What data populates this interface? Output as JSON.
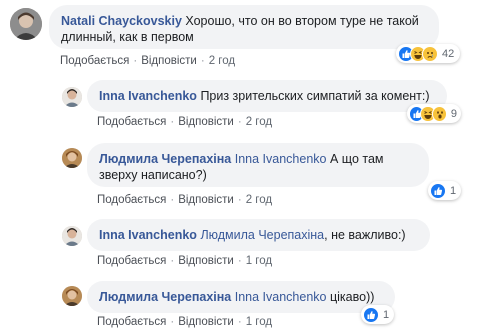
{
  "comments": [
    {
      "author": "Natali Chayckovskiy",
      "mention": "",
      "text": "Хорошо, что он во втором туре не такой длинный, как в первом",
      "actions": {
        "like": "Подобається",
        "reply": "Відповісти",
        "time": "2 год"
      },
      "reactions": {
        "icons": [
          "like-icon",
          "haha-icon",
          "sad-icon"
        ],
        "count": "42"
      }
    },
    {
      "author": "Inna Ivanchenko",
      "mention": "",
      "text": "Приз зрительских симпатий за комент:)",
      "actions": {
        "like": "Подобається",
        "reply": "Відповісти",
        "time": "2 год"
      },
      "reactions": {
        "icons": [
          "like-icon",
          "haha-icon",
          "wow-icon"
        ],
        "count": "9"
      }
    },
    {
      "author": "Людмила Черепахіна",
      "mention": "Inna Ivanchenko",
      "text": "А що там зверху написано?)",
      "actions": {
        "like": "Подобається",
        "reply": "Відповісти",
        "time": "2 год"
      },
      "reactions": {
        "icons": [
          "like-icon"
        ],
        "count": "1"
      }
    },
    {
      "author": "Inna Ivanchenko",
      "mention": "Людмила Черепахіна",
      "text": ", не важливо:)",
      "actions": {
        "like": "Подобається",
        "reply": "Відповісти",
        "time": "1 год"
      },
      "reactions": null
    },
    {
      "author": "Людмила Черепахіна",
      "mention": "Inna Ivanchenko",
      "text": "цікаво))",
      "actions": {
        "like": "Подобається",
        "reply": "Відповісти",
        "time": "1 год"
      },
      "reactions": {
        "icons": [
          "like-icon"
        ],
        "count": "1"
      }
    }
  ],
  "colors": {
    "author": "#385898",
    "bubble": "#f2f3f5",
    "like": "#1877f2",
    "emoji": "#f7c23b"
  }
}
